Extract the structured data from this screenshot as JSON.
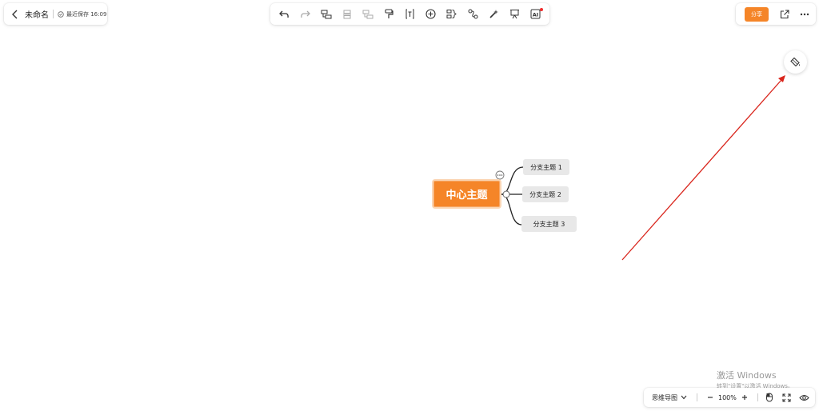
{
  "document": {
    "title": "未命名",
    "save_status": "最近保存 16:09"
  },
  "toolbar": {
    "items": [
      {
        "name": "undo-icon"
      },
      {
        "name": "redo-icon"
      },
      {
        "name": "add-subtopic-icon"
      },
      {
        "name": "add-sibling-topic-icon"
      },
      {
        "name": "add-parent-topic-icon"
      },
      {
        "name": "format-painter-icon"
      },
      {
        "name": "text-icon"
      },
      {
        "name": "insert-icon"
      },
      {
        "name": "summary-icon"
      },
      {
        "name": "relationship-icon"
      },
      {
        "name": "magic-wand-icon"
      },
      {
        "name": "presentation-icon"
      },
      {
        "name": "ai-icon"
      }
    ],
    "ai_badge_color": "#f02d2d"
  },
  "share": {
    "label": "分享",
    "color": "#f58528"
  },
  "mindmap": {
    "central_topic": "中心主题",
    "central_color": "#f58528",
    "branches": [
      "分支主题 1",
      "分支主题 2",
      "分支主题 3"
    ]
  },
  "bottom_bar": {
    "view_mode": "思维导图",
    "zoom": "100%"
  },
  "watermark": {
    "line1": "激活 Windows",
    "line2": "转到\"设置\"以激活 Windows。"
  },
  "annotation": {
    "arrow_color": "#d9251c"
  }
}
